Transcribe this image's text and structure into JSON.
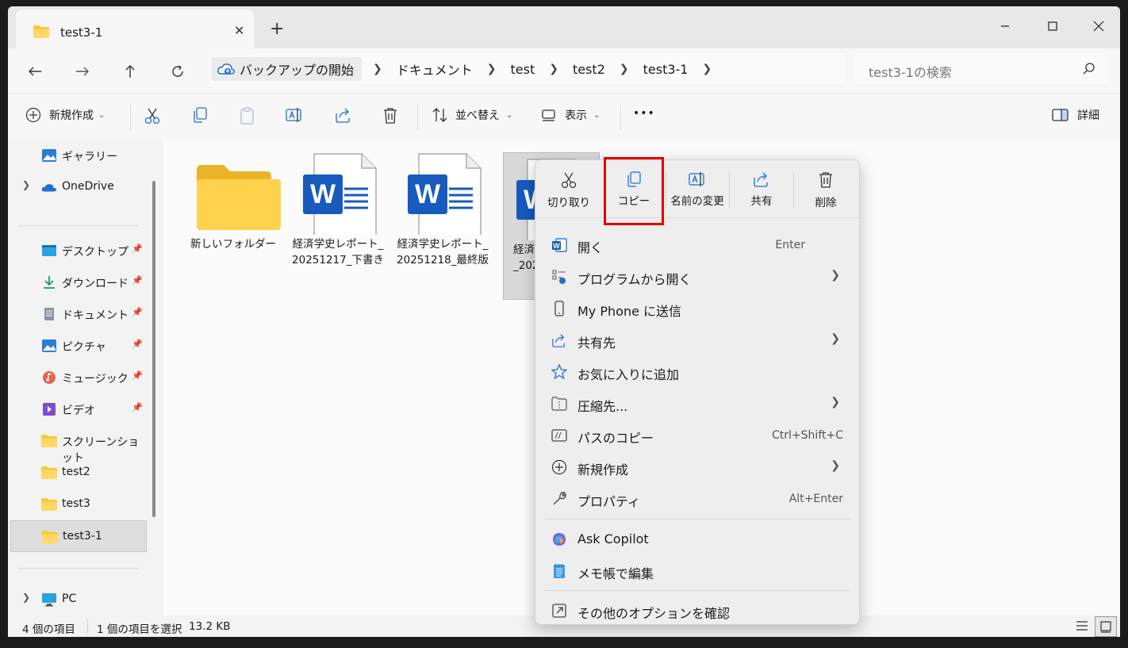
{
  "window": {
    "tab_title": "test3-1",
    "new_tab": "+",
    "close_tab": "✕"
  },
  "address": {
    "home": "バックアップの開始",
    "crumbs": [
      "ドキュメント",
      "test",
      "test2",
      "test3-1"
    ],
    "search_placeholder": "test3-1の検索"
  },
  "toolbar": {
    "new": "新規作成",
    "sort": "並べ替え",
    "view": "表示",
    "more": "•••",
    "details": "詳細"
  },
  "sidebar": {
    "items": [
      {
        "label": "ギャラリー"
      },
      {
        "label": "OneDrive"
      },
      {
        "label": "デスクトップ"
      },
      {
        "label": "ダウンロード"
      },
      {
        "label": "ドキュメント"
      },
      {
        "label": "ピクチャ"
      },
      {
        "label": "ミュージック"
      },
      {
        "label": "ビデオ"
      },
      {
        "label": "スクリーンショット"
      },
      {
        "label": "test2"
      },
      {
        "label": "test3"
      },
      {
        "label": "test3-1"
      },
      {
        "label": "PC"
      }
    ]
  },
  "files": [
    {
      "name": "新しいフォルダー"
    },
    {
      "name": "経済学史レポート_20251217_下書き"
    },
    {
      "name": "経済学史レポート_20251218_最終版"
    },
    {
      "name": "経済学史レポート_2025"
    }
  ],
  "status": {
    "count": "4 個の項目",
    "selected": "1 個の項目を選択",
    "size": "13.2 KB"
  },
  "context_menu": {
    "quick_actions": [
      "切り取り",
      "コピー",
      "名前の変更",
      "共有",
      "削除"
    ],
    "items": [
      {
        "label": "開く",
        "shortcut": "Enter"
      },
      {
        "label": "プログラムから開く",
        "shortcut": ""
      },
      {
        "label": "My Phone に送信",
        "shortcut": ""
      },
      {
        "label": "共有先",
        "shortcut": ""
      },
      {
        "label": "お気に入りに追加",
        "shortcut": ""
      },
      {
        "label": "圧縮先...",
        "shortcut": ""
      },
      {
        "label": "パスのコピー",
        "shortcut": "Ctrl+Shift+C"
      },
      {
        "label": "新規作成",
        "shortcut": ""
      },
      {
        "label": "プロパティ",
        "shortcut": "Alt+Enter"
      },
      {
        "label": "Ask Copilot",
        "shortcut": ""
      },
      {
        "label": "メモ帳で編集",
        "shortcut": ""
      },
      {
        "label": "その他のオプションを確認",
        "shortcut": ""
      }
    ]
  },
  "colors": {
    "word_blue": "#185abd",
    "folder_yellow": "#f8c93c",
    "highlight_red": "#e00000"
  }
}
